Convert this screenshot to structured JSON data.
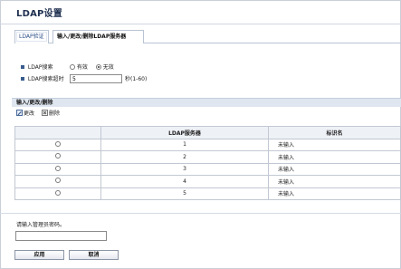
{
  "page": {
    "title": "LDAP设置"
  },
  "tabs": [
    {
      "label": "LDAP验证"
    },
    {
      "label": "输入/更改/删除LDAP服务器"
    }
  ],
  "settings": {
    "ldap_search": {
      "label": "LDAP搜索",
      "options": [
        {
          "label": "有效",
          "checked": false
        },
        {
          "label": "无效",
          "checked": true
        }
      ]
    },
    "ldap_timeout": {
      "label": "LDAP搜索超时",
      "value": "5",
      "unit": "秒(1-60)"
    }
  },
  "section": {
    "title": "输入/更改/删除"
  },
  "toolbar": {
    "change_label": "更改",
    "delete_label": "删除"
  },
  "table": {
    "headers": [
      "",
      "LDAP服务器",
      "标识名"
    ],
    "rows": [
      {
        "num": "1",
        "status": "未输入"
      },
      {
        "num": "2",
        "status": "未输入"
      },
      {
        "num": "3",
        "status": "未输入"
      },
      {
        "num": "4",
        "status": "未输入"
      },
      {
        "num": "5",
        "status": "未输入"
      }
    ]
  },
  "password": {
    "label": "请输入管理员密码。",
    "value": ""
  },
  "buttons": {
    "apply": "应用",
    "cancel": "取消"
  },
  "colors": {
    "accent": "#3a5c8e",
    "section_bg": "#dfe6f0"
  }
}
